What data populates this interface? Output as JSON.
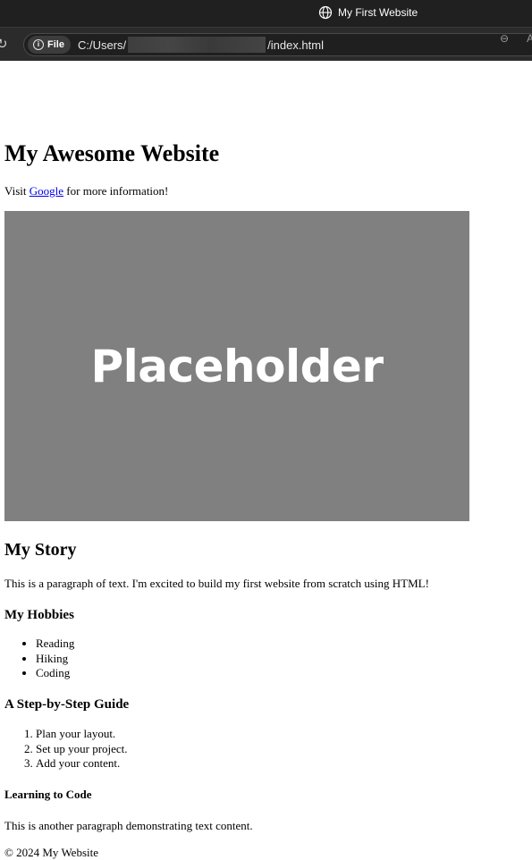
{
  "browser": {
    "tab_title": "My First Website",
    "site_chip_label": "File",
    "url_prefix": "C:/Users/",
    "url_suffix": "/index.html",
    "right_edge_glyph": "A"
  },
  "page": {
    "title": "My Awesome Website",
    "intro": {
      "before": "Visit ",
      "link_text": "Google",
      "after": " for more information!"
    },
    "image_text": "Placeholder",
    "story_heading": "My Story",
    "paragraph1": "This is a paragraph of text. I'm excited to build my first website from scratch using HTML!",
    "hobbies_heading": "My Hobbies",
    "hobbies": [
      "Reading",
      "Hiking",
      "Coding"
    ],
    "guide_heading": "A Step-by-Step Guide",
    "guide_steps": [
      "Plan your layout.",
      "Set up your project.",
      "Add your content."
    ],
    "learning_heading": "Learning to Code",
    "paragraph2": "This is another paragraph demonstrating text content.",
    "footer": "© 2024 My Website"
  },
  "colors": {
    "chrome_dark": "#202020",
    "toolbar": "#2b2b2b",
    "link": "#0000ee",
    "placeholder_bg": "#808080"
  },
  "icons": {
    "tab": "globe-icon",
    "reload": "reload-icon",
    "site_info": "info-icon",
    "zoom": "zoom-out-icon"
  }
}
